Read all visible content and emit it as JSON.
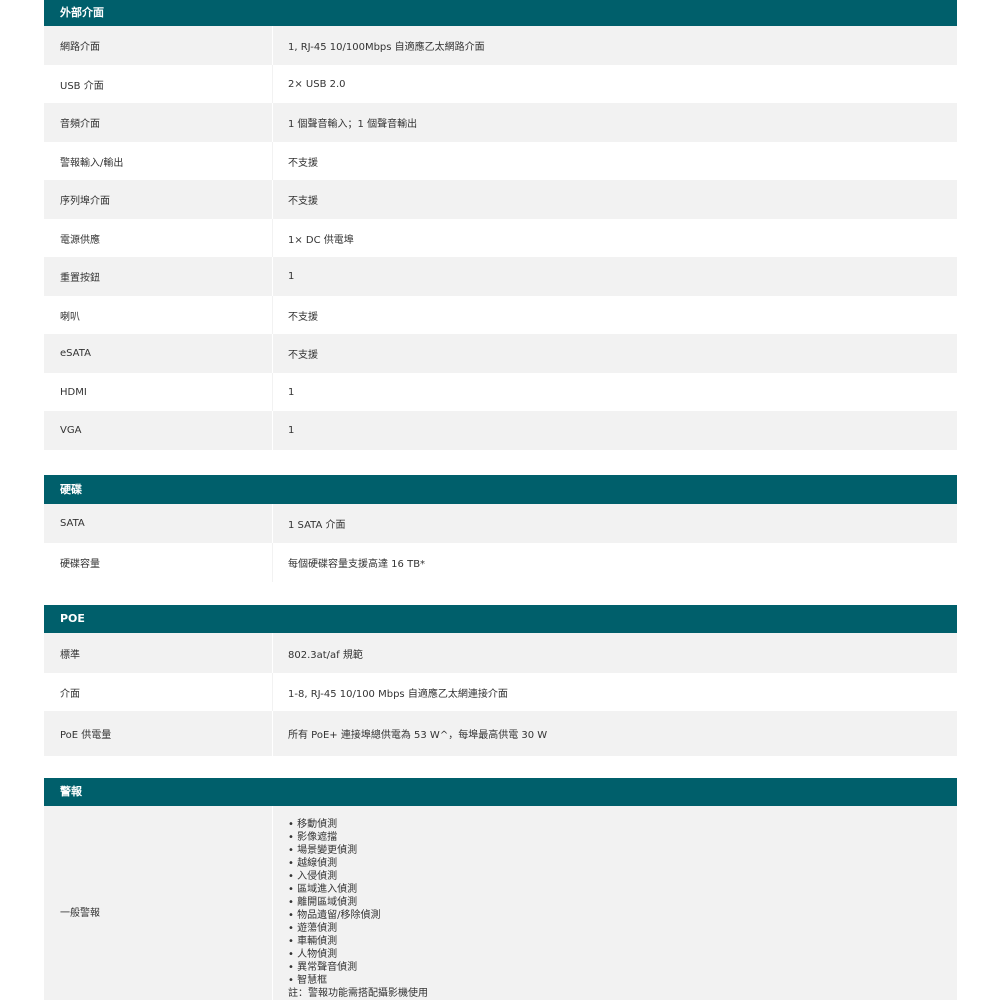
{
  "sections": [
    {
      "title": "外部介面",
      "rows": [
        {
          "label": "網路介面",
          "value": "1, RJ-45 10/100Mbps 自適應乙太網路介面"
        },
        {
          "label": "USB 介面",
          "value": "2× USB 2.0"
        },
        {
          "label": "音頻介面",
          "value": "1 個聲音輸入；1 個聲音輸出"
        },
        {
          "label": "警報輸入/輸出",
          "value": "不支援"
        },
        {
          "label": "序列埠介面",
          "value": "不支援"
        },
        {
          "label": "電源供應",
          "value": "1× DC 供電埠"
        },
        {
          "label": "重置按鈕",
          "value": "1"
        },
        {
          "label": "喇叭",
          "value": "不支援"
        },
        {
          "label": "eSATA",
          "value": "不支援"
        },
        {
          "label": "HDMI",
          "value": "1"
        },
        {
          "label": "VGA",
          "value": "1"
        }
      ]
    },
    {
      "title": "硬碟",
      "rows": [
        {
          "label": "SATA",
          "value": "1 SATA 介面"
        },
        {
          "label": "硬碟容量",
          "value": "每個硬碟容量支援高達 16 TB*"
        }
      ]
    },
    {
      "title": "POE",
      "rows": [
        {
          "label": "標準",
          "value": "802.3at/af 規範"
        },
        {
          "label": "介面",
          "value": "1-8, RJ-45 10/100 Mbps 自適應乙太網連接介面"
        },
        {
          "label": "PoE 供電量",
          "value": "所有 PoE+ 連接埠總供電為 53 W^，每埠最高供電 30 W"
        }
      ]
    },
    {
      "title": "警報",
      "rows": [
        {
          "label": "一般警報",
          "items": [
            "移動偵測",
            "影像遮擋",
            "場景變更偵測",
            "越線偵測",
            "入侵偵測",
            "區域進入偵測",
            "離開區域偵測",
            "物品遺留/移除偵測",
            "遊蕩偵測",
            "車輛偵測",
            "人物偵測",
            "異常聲音偵測",
            "智慧框"
          ],
          "note": "註：警報功能需搭配攝影機使用"
        }
      ]
    }
  ]
}
